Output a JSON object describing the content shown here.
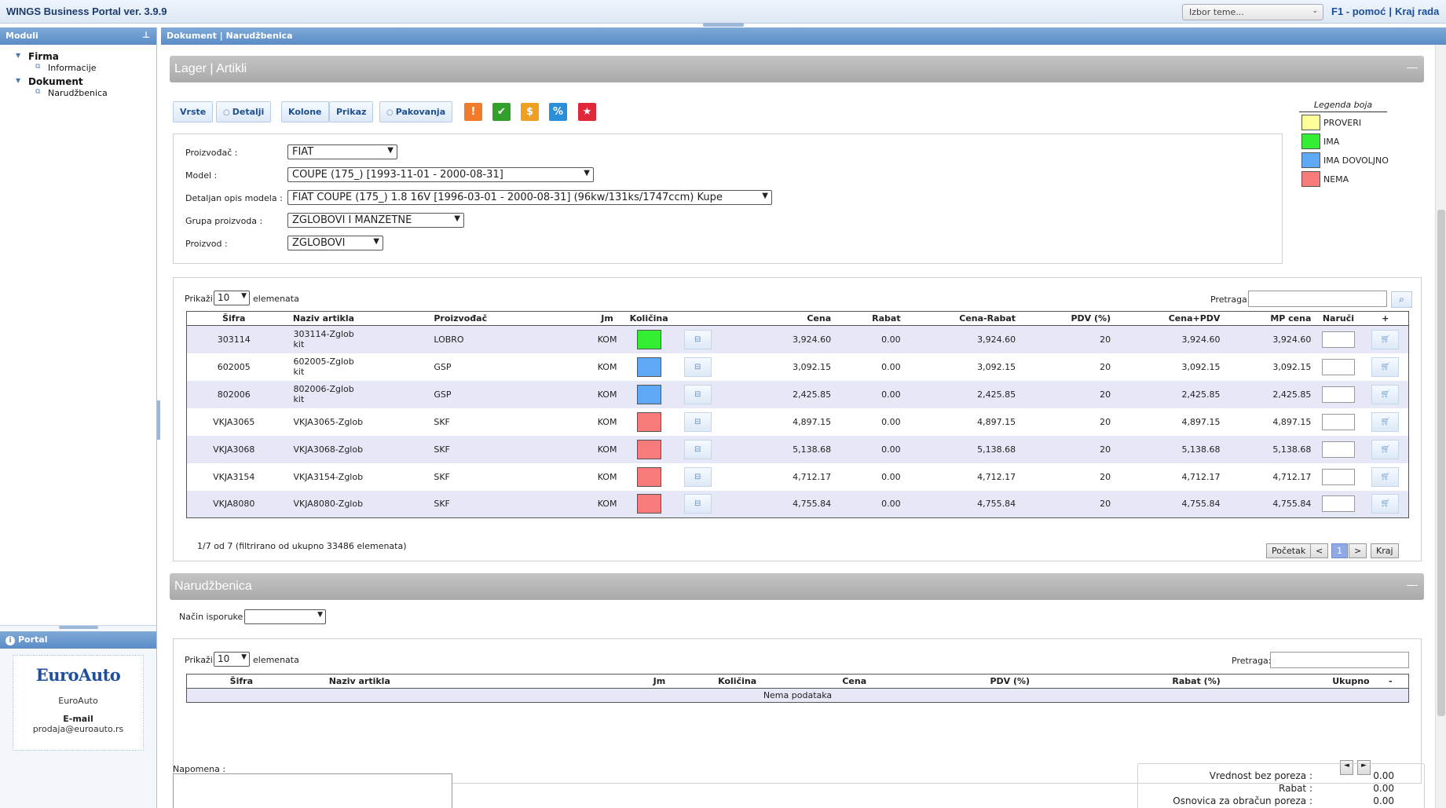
{
  "app": {
    "title": "WINGS Business Portal ver. 3.9.9",
    "theme_select": "Izbor teme...",
    "help_link": "F1 - pomoć",
    "separator": "|",
    "exit_link": "Kraj rada"
  },
  "sidebar": {
    "title": "Moduli",
    "tree": [
      {
        "label": "Firma",
        "children": [
          {
            "label": "Informacije"
          }
        ]
      },
      {
        "label": "Dokument",
        "children": [
          {
            "label": "Narudžbenica"
          }
        ]
      }
    ],
    "portal": {
      "title": "Portal",
      "logo": "EuroAuto",
      "company": "EuroAuto",
      "email_label": "E-mail",
      "email": "prodaja@euroauto.rs"
    }
  },
  "breadcrumb": "Dokument | Narudžbenica",
  "lager": {
    "title": "Lager | Artikli",
    "collapse": "—",
    "buttons": {
      "vrste": "Vrste",
      "detalji": "Detalji",
      "kolone": "Kolone",
      "prikaz": "Prikaz",
      "pakovanja": "Pakovanja"
    },
    "icon_buttons": [
      {
        "icon": "exclamation-icon",
        "glyph": "!",
        "color": "#f07b2a"
      },
      {
        "icon": "check-icon",
        "glyph": "✔",
        "color": "#33a02c"
      },
      {
        "icon": "dollar-icon",
        "glyph": "$",
        "color": "#f0a020"
      },
      {
        "icon": "percent-icon",
        "glyph": "%",
        "color": "#2b8fd8"
      },
      {
        "icon": "star-icon",
        "glyph": "★",
        "color": "#e0283a"
      }
    ],
    "legend": {
      "title": "Legenda boja",
      "items": [
        {
          "label": "PROVERI",
          "color": "#ffff99"
        },
        {
          "label": "IMA",
          "color": "#33ee33"
        },
        {
          "label": "IMA DOVOLJNO",
          "color": "#5ea8f5"
        },
        {
          "label": "NEMA",
          "color": "#f77b7b"
        }
      ]
    },
    "filters": {
      "proizvodjac": {
        "label": "Proizvođač :",
        "value": "FIAT"
      },
      "model": {
        "label": "Model :",
        "value": "COUPE (175_) [1993-11-01 - 2000-08-31]"
      },
      "detaljan": {
        "label": "Detaljan opis modela :",
        "value": "FIAT COUPE (175_) 1.8 16V [1996-03-01 - 2000-08-31] (96kw/131ks/1747ccm) Kupe"
      },
      "grupa": {
        "label": "Grupa proizvoda :",
        "value": "ZGLOBOVI I MANZETNE"
      },
      "proizvod": {
        "label": "Proizvod :",
        "value": "ZGLOBOVI"
      }
    },
    "show_label": "Prikaži",
    "show_value": "10",
    "show_suffix": "elemenata",
    "search_label": "Pretraga:",
    "columns": [
      "Šifra",
      "Naziv artikla",
      "Proizvođač",
      "Jm",
      "Količina",
      "",
      "Cena",
      "Rabat",
      "Cena-Rabat",
      "PDV (%)",
      "Cena+PDV",
      "MP cena",
      "Naruči",
      "+"
    ],
    "rows": [
      {
        "sifra": "303114",
        "naziv": "303114-Zglob kit",
        "proizvodjac": "LOBRO",
        "jm": "KOM",
        "color": "#33ee33",
        "cena": "3,924.60",
        "rabat": "0.00",
        "cena_rabat": "3,924.60",
        "pdv": "20",
        "cena_pdv": "3,924.60",
        "mp": "3,924.60"
      },
      {
        "sifra": "602005",
        "naziv": "602005-Zglob kit",
        "proizvodjac": "GSP",
        "jm": "KOM",
        "color": "#5ea8f5",
        "cena": "3,092.15",
        "rabat": "0.00",
        "cena_rabat": "3,092.15",
        "pdv": "20",
        "cena_pdv": "3,092.15",
        "mp": "3,092.15"
      },
      {
        "sifra": "802006",
        "naziv": "802006-Zglob kit",
        "proizvodjac": "GSP",
        "jm": "KOM",
        "color": "#5ea8f5",
        "cena": "2,425.85",
        "rabat": "0.00",
        "cena_rabat": "2,425.85",
        "pdv": "20",
        "cena_pdv": "2,425.85",
        "mp": "2,425.85"
      },
      {
        "sifra": "VKJA3065",
        "naziv": "VKJA3065-Zglob",
        "proizvodjac": "SKF",
        "jm": "KOM",
        "color": "#f77b7b",
        "cena": "4,897.15",
        "rabat": "0.00",
        "cena_rabat": "4,897.15",
        "pdv": "20",
        "cena_pdv": "4,897.15",
        "mp": "4,897.15"
      },
      {
        "sifra": "VKJA3068",
        "naziv": "VKJA3068-Zglob",
        "proizvodjac": "SKF",
        "jm": "KOM",
        "color": "#f77b7b",
        "cena": "5,138.68",
        "rabat": "0.00",
        "cena_rabat": "5,138.68",
        "pdv": "20",
        "cena_pdv": "5,138.68",
        "mp": "5,138.68"
      },
      {
        "sifra": "VKJA3154",
        "naziv": "VKJA3154-Zglob",
        "proizvodjac": "SKF",
        "jm": "KOM",
        "color": "#f77b7b",
        "cena": "4,712.17",
        "rabat": "0.00",
        "cena_rabat": "4,712.17",
        "pdv": "20",
        "cena_pdv": "4,712.17",
        "mp": "4,712.17"
      },
      {
        "sifra": "VKJA8080",
        "naziv": "VKJA8080-Zglob",
        "proizvodjac": "SKF",
        "jm": "KOM",
        "color": "#f77b7b",
        "cena": "4,755.84",
        "rabat": "0.00",
        "cena_rabat": "4,755.84",
        "pdv": "20",
        "cena_pdv": "4,755.84",
        "mp": "4,755.84"
      }
    ],
    "info": "1/7 od 7 (filtrirano od ukupno 33486 elemenata)",
    "pager": {
      "first": "Početak",
      "prev": "<",
      "current": "1",
      "next": ">",
      "last": "Kraj"
    }
  },
  "narudzbenica": {
    "title": "Narudžbenica",
    "collapse": "—",
    "delivery_label": "Način isporuke :",
    "delivery_value": "",
    "show_label": "Prikaži",
    "show_value": "10",
    "show_suffix": "elemenata",
    "search_label": "Pretraga:",
    "columns": [
      "Šifra",
      "Naziv artikla",
      "Jm",
      "Količina",
      "Cena",
      "PDV (%)",
      "Rabat (%)",
      "Ukupno",
      "-"
    ],
    "empty": "Nema podataka",
    "nav_prev": "◄",
    "nav_next": "►",
    "note_label": "Napomena :",
    "totals": [
      {
        "label": "Vrednost bez poreza :",
        "value": "0.00"
      },
      {
        "label": "Rabat :",
        "value": "0.00"
      },
      {
        "label": "Osnovica za obračun poreza :",
        "value": "0.00"
      }
    ]
  }
}
